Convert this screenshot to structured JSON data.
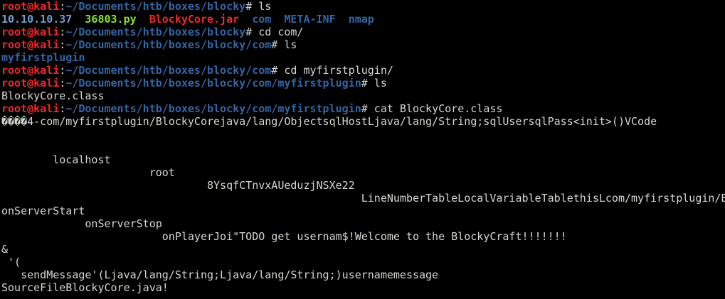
{
  "colors": {
    "background": "#000000",
    "text": "#d3d7cf",
    "user": "#ef2929",
    "path": "#3465a4",
    "py_file": "#8ae234",
    "jar_file": "#ef2929"
  },
  "prompt": {
    "user": "root@kali",
    "separator": ":",
    "symbol": "# "
  },
  "lines": [
    {
      "path": "~/Documents/htb/boxes/blocky",
      "cmd": "ls"
    },
    {
      "listing": [
        "10.10.10.37",
        "36803.py",
        "BlockyCore.jar",
        "com",
        "META-INF",
        "nmap"
      ]
    },
    {
      "path": "~/Documents/htb/boxes/blocky",
      "cmd": "cd com/"
    },
    {
      "path": "~/Documents/htb/boxes/blocky/com",
      "cmd": "ls"
    },
    {
      "dir_out": "myfirstplugin"
    },
    {
      "path": "~/Documents/htb/boxes/blocky/com",
      "cmd": "cd myfirstplugin/"
    },
    {
      "path": "~/Documents/htb/boxes/blocky/com/myfirstplugin",
      "cmd": "ls"
    },
    {
      "out": "BlockyCore.class"
    },
    {
      "path": "~/Documents/htb/boxes/blocky/com/myfirstplugin",
      "cmd": "cat BlockyCore.class"
    },
    {
      "out": "����4-com/myfirstplugin/BlockyCorejava/lang/ObjectsqlHostLjava/lang/String;sqlUsersqlPass<init>()VCode"
    },
    {
      "out": ""
    },
    {
      "out": ""
    },
    {
      "out": "        localhost"
    },
    {
      "out": "                       root"
    },
    {
      "out": "                                8YsqfCTnvxAUeduzjNSXe22"
    },
    {
      "out": "                                                        LineNumberTableLocalVariableTablethisLcom/myfirstplugin/Bl"
    },
    {
      "out": "onServerStart"
    },
    {
      "out": "             onServerStop"
    },
    {
      "out": "                         onPlayerJoi\"TODO get usernam$!Welcome to the BlockyCraft!!!!!!!"
    },
    {
      "out": "&"
    },
    {
      "out": " '("
    },
    {
      "out": "   sendMessage'(Ljava/lang/String;Ljava/lang/String;)usernamemessage"
    },
    {
      "out": "SourceFileBlockyCore.java!"
    }
  ]
}
